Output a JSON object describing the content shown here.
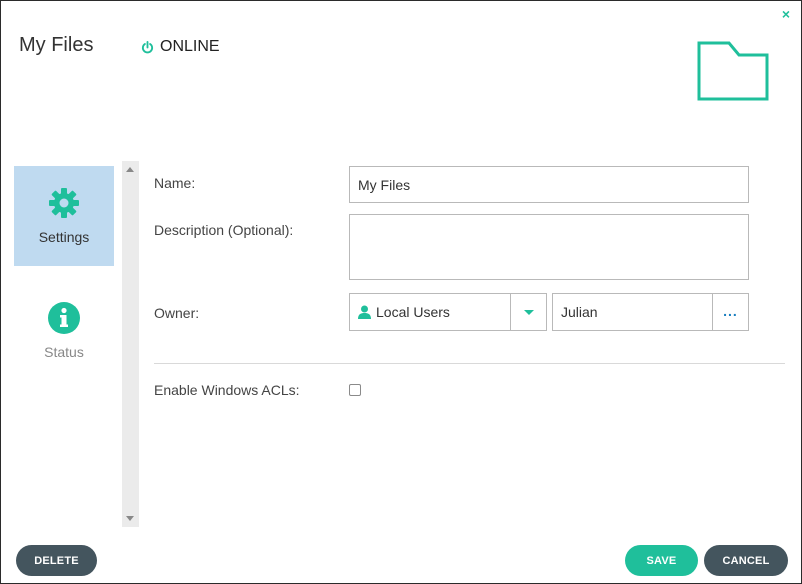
{
  "header": {
    "title": "My Files",
    "status": "ONLINE",
    "close_glyph": "×",
    "close_icon": "close-icon",
    "status_icon": "power-icon",
    "big_icon": "folder-icon"
  },
  "nav": {
    "items": [
      {
        "label": "Settings",
        "icon": "gear-icon",
        "active": true
      },
      {
        "label": "Status",
        "icon": "info-icon",
        "active": false
      }
    ]
  },
  "form": {
    "name_label": "Name:",
    "name_value": "My Files",
    "description_label": "Description (Optional):",
    "description_value": "",
    "owner_label": "Owner:",
    "owner_type": "Local Users",
    "owner_name": "Julian",
    "owner_more": "...",
    "acl_label": "Enable Windows ACLs:",
    "acl_checked": false
  },
  "footer": {
    "delete_label": "DELETE",
    "save_label": "SAVE",
    "cancel_label": "CANCEL"
  },
  "colors": {
    "accent": "#1fbf9b",
    "nav_active_bg": "#bfdaf0",
    "dark_button": "#44555e",
    "link_blue": "#1a7fc0"
  }
}
